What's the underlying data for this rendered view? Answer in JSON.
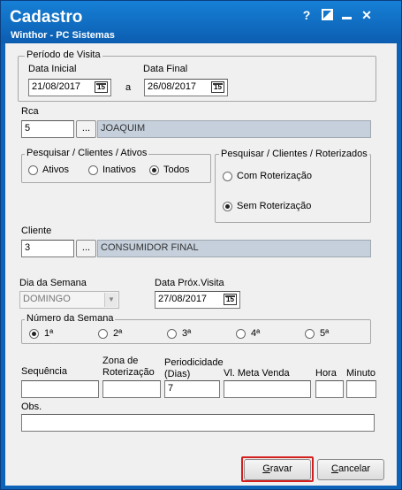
{
  "window": {
    "title": "Cadastro",
    "subtitle": "Winthor - PC Sistemas",
    "help": "?",
    "close": "✕"
  },
  "periodo": {
    "title": "Período de Visita",
    "data_inicial_label": "Data Inicial",
    "data_inicial_value": "21/08/2017",
    "a_label": "a",
    "data_final_label": "Data Final",
    "data_final_value": "26/08/2017",
    "cal_text": "15"
  },
  "rca": {
    "label": "Rca",
    "code": "5",
    "dots": "...",
    "name": "JOAQUIM"
  },
  "pesquisar_clientes": {
    "title": "Pesquisar / Clientes / Ativos",
    "options": [
      "Ativos",
      "Inativos",
      "Todos"
    ],
    "selected": "Todos"
  },
  "pesquisar_roteirizados": {
    "title": "Pesquisar / Clientes / Roterizados",
    "options": [
      "Com Roterização",
      "Sem Roterização"
    ],
    "selected": "Sem Roterização"
  },
  "cliente": {
    "label": "Cliente",
    "code": "3",
    "dots": "...",
    "name": "CONSUMIDOR FINAL"
  },
  "dia_semana": {
    "label": "Dia da Semana",
    "value": "DOMINGO"
  },
  "data_prox_visita": {
    "label": "Data Próx.Visita",
    "value": "27/08/2017"
  },
  "numero_semana": {
    "title": "Número da Semana",
    "options": [
      "1ª",
      "2ª",
      "3ª",
      "4ª",
      "5ª"
    ],
    "selected": "1ª"
  },
  "campos": {
    "sequencia_label": "Sequência",
    "zona_label_1": "Zona de",
    "zona_label_2": "Roterização",
    "periodicidade_label_1": "Periodicidade",
    "periodicidade_label_2": "(Dias)",
    "periodicidade_value": "7",
    "meta_label": "Vl. Meta Venda",
    "hora_label": "Hora",
    "minuto_label": "Minuto",
    "obs_label": "Obs."
  },
  "buttons": {
    "gravar_u": "G",
    "gravar_rest": "ravar",
    "cancelar_u": "C",
    "cancelar_rest": "ancelar"
  }
}
